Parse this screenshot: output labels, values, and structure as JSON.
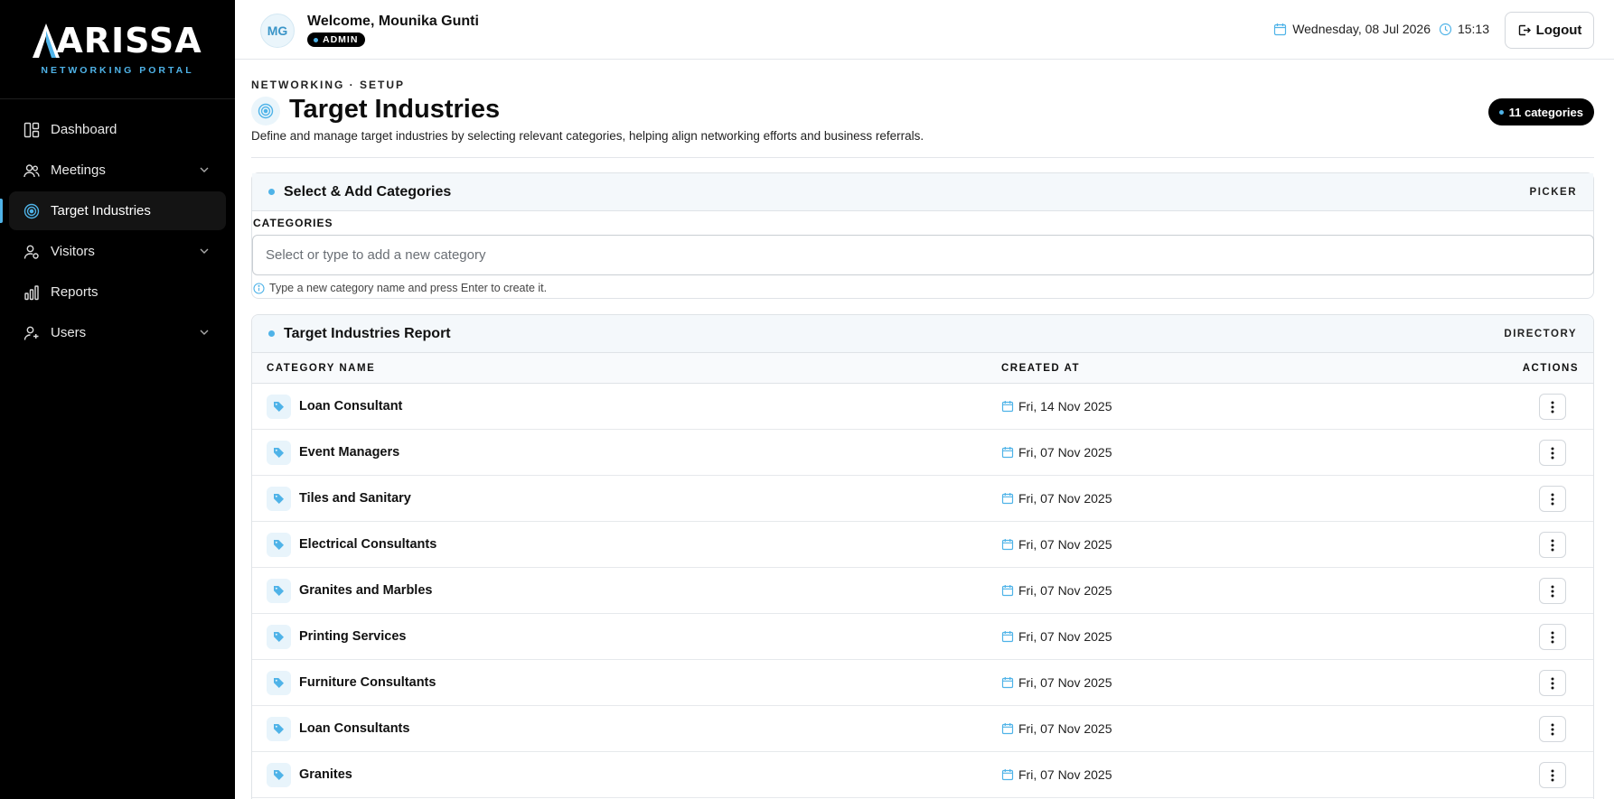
{
  "brand": {
    "name": "ARISSA",
    "subtitle": "NETWORKING PORTAL",
    "accent": "#4fb3e8"
  },
  "sidebar": {
    "items": [
      {
        "label": "Dashboard",
        "icon": "dashboard-icon"
      },
      {
        "label": "Meetings",
        "icon": "people-icon"
      },
      {
        "label": "Target Industries",
        "icon": "target-icon",
        "active": true
      },
      {
        "label": "Visitors",
        "icon": "visitor-icon"
      },
      {
        "label": "Reports",
        "icon": "chart-icon"
      },
      {
        "label": "Users",
        "icon": "user-icon"
      }
    ]
  },
  "header": {
    "avatar_initials": "MG",
    "welcome": "Welcome, Mounika Gunti",
    "role": "ADMIN",
    "date": "Wednesday, 08 Jul 2026",
    "time": "15:13",
    "logout": "Logout"
  },
  "page": {
    "eyebrow": "NETWORKING · SETUP",
    "title": "Target Industries",
    "description": "Define and manage target industries by selecting relevant categories, helping align networking efforts and business referrals.",
    "count": "11 categories"
  },
  "picker": {
    "title": "Select & Add Categories",
    "tag": "PICKER",
    "label": "CATEGORIES",
    "placeholder": "Select or type to add a new category",
    "hint": "Type a new category name and press Enter to create it."
  },
  "report": {
    "title": "Target Industries Report",
    "tag": "DIRECTORY",
    "columns": [
      "CATEGORY NAME",
      "CREATED AT",
      "ACTIONS"
    ],
    "rows": [
      {
        "name": "Loan Consultant",
        "created": "Fri, 14 Nov 2025"
      },
      {
        "name": "Event Managers",
        "created": "Fri, 07 Nov 2025"
      },
      {
        "name": "Tiles and Sanitary",
        "created": "Fri, 07 Nov 2025"
      },
      {
        "name": "Electrical Consultants",
        "created": "Fri, 07 Nov 2025"
      },
      {
        "name": "Granites and Marbles",
        "created": "Fri, 07 Nov 2025"
      },
      {
        "name": "Printing Services",
        "created": "Fri, 07 Nov 2025"
      },
      {
        "name": "Furniture Consultants",
        "created": "Fri, 07 Nov 2025"
      },
      {
        "name": "Loan Consultants",
        "created": "Fri, 07 Nov 2025"
      },
      {
        "name": "Granites",
        "created": "Fri, 07 Nov 2025"
      }
    ]
  }
}
